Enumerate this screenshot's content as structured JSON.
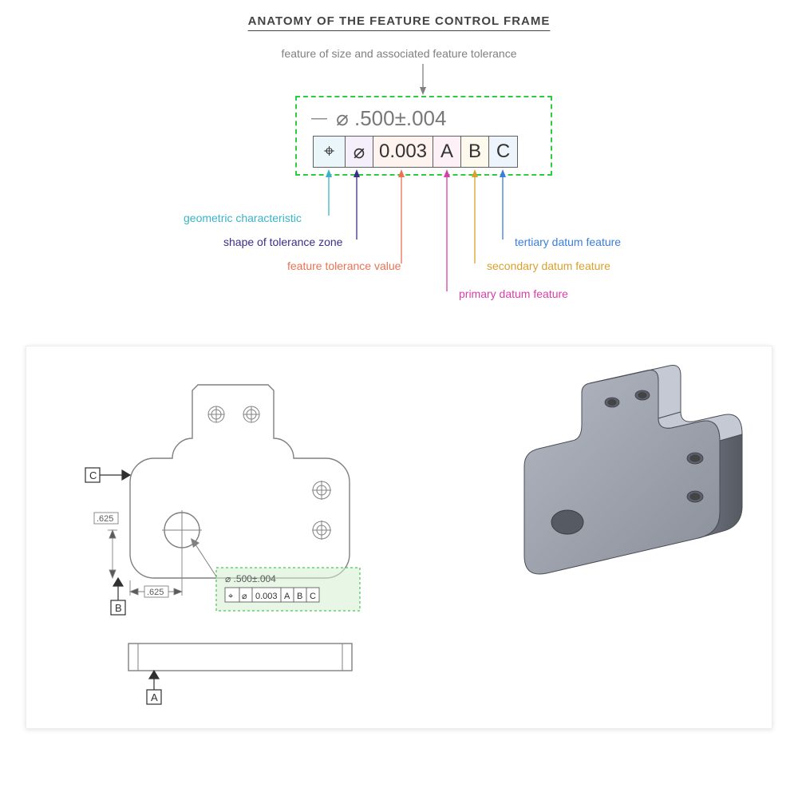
{
  "title": "ANATOMY OF THE FEATURE CONTROL FRAME",
  "callouts": {
    "top": "feature of size and associated feature tolerance",
    "geometric": "geometric characteristic",
    "shape": "shape of tolerance zone",
    "value": "feature tolerance value",
    "primary": "primary datum feature",
    "secondary": "secondary datum feature",
    "tertiary": "tertiary datum feature"
  },
  "feature_size": "⌀ .500±.004",
  "fcf": {
    "symbol": "⌖",
    "zone": "⌀",
    "tol": "0.003",
    "d1": "A",
    "d2": "B",
    "d3": "C"
  },
  "drawing": {
    "dim1": ".625",
    "dim2": ".625",
    "datumA": "A",
    "datumB": "B",
    "datumC": "C",
    "mini_size": "⌀ .500±.004",
    "mini_fcf": [
      "⌖",
      "⌀",
      "0.003",
      "A",
      "B",
      "C"
    ]
  }
}
